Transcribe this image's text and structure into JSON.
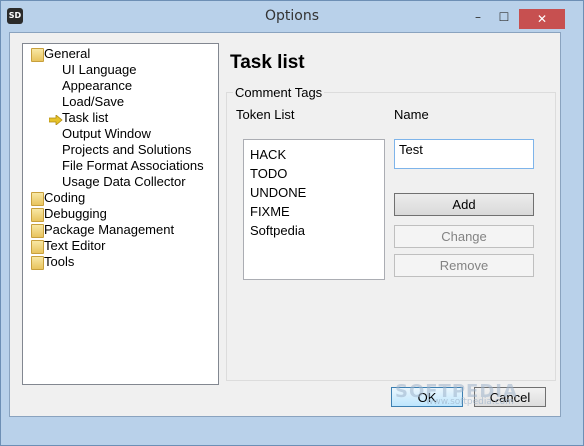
{
  "window": {
    "title": "Options",
    "app_icon_text": "SD",
    "controls": {
      "minimize": "–",
      "maximize": "☐",
      "close": "✕"
    }
  },
  "tree": {
    "items": [
      {
        "label": "General",
        "type": "folder"
      },
      {
        "label": "UI Language",
        "type": "child"
      },
      {
        "label": "Appearance",
        "type": "child"
      },
      {
        "label": "Load/Save",
        "type": "child"
      },
      {
        "label": "Task list",
        "type": "child-selected"
      },
      {
        "label": "Output Window",
        "type": "child"
      },
      {
        "label": "Projects and Solutions",
        "type": "child"
      },
      {
        "label": "File Format Associations",
        "type": "child"
      },
      {
        "label": "Usage Data Collector",
        "type": "child"
      },
      {
        "label": "Coding",
        "type": "folder"
      },
      {
        "label": "Debugging",
        "type": "folder"
      },
      {
        "label": "Package Management",
        "type": "folder"
      },
      {
        "label": "Text Editor",
        "type": "folder"
      },
      {
        "label": "Tools",
        "type": "folder"
      }
    ]
  },
  "panel": {
    "heading": "Task list",
    "group_label": "Comment Tags",
    "token_list_label": "Token List",
    "name_label": "Name",
    "tokens": [
      "HACK",
      "TODO",
      "UNDONE",
      "FIXME",
      "Softpedia"
    ],
    "name_value": "Test",
    "buttons": {
      "add": "Add",
      "change": "Change",
      "remove": "Remove"
    }
  },
  "footer": {
    "ok": "OK",
    "cancel": "Cancel",
    "watermark": "SOFTPEDIA",
    "watermark_url": "www.softpedia.com"
  }
}
